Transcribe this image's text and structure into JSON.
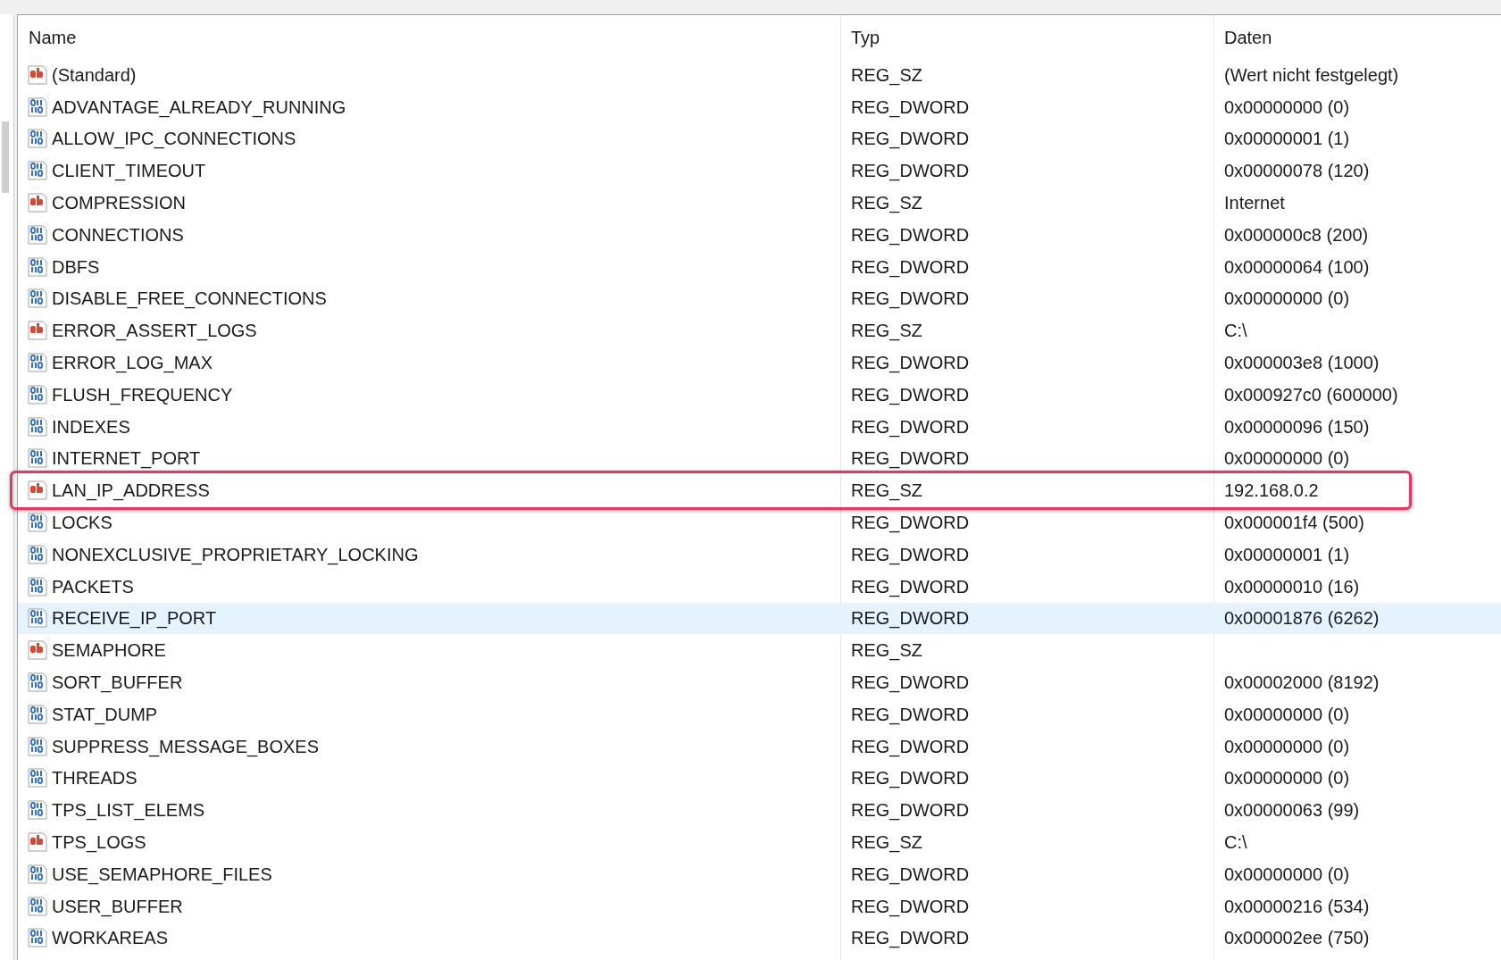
{
  "table": {
    "columns": [
      "Name",
      "Typ",
      "Daten"
    ],
    "rows": [
      {
        "kind": "sz",
        "name": "(Standard)",
        "type": "REG_SZ",
        "data": "(Wert nicht festgelegt)",
        "selected": false,
        "highlighted": false
      },
      {
        "kind": "dword",
        "name": "ADVANTAGE_ALREADY_RUNNING",
        "type": "REG_DWORD",
        "data": "0x00000000 (0)",
        "selected": false,
        "highlighted": false
      },
      {
        "kind": "dword",
        "name": "ALLOW_IPC_CONNECTIONS",
        "type": "REG_DWORD",
        "data": "0x00000001 (1)",
        "selected": false,
        "highlighted": false
      },
      {
        "kind": "dword",
        "name": "CLIENT_TIMEOUT",
        "type": "REG_DWORD",
        "data": "0x00000078 (120)",
        "selected": false,
        "highlighted": false
      },
      {
        "kind": "sz",
        "name": "COMPRESSION",
        "type": "REG_SZ",
        "data": "Internet",
        "selected": false,
        "highlighted": false
      },
      {
        "kind": "dword",
        "name": "CONNECTIONS",
        "type": "REG_DWORD",
        "data": "0x000000c8 (200)",
        "selected": false,
        "highlighted": false
      },
      {
        "kind": "dword",
        "name": "DBFS",
        "type": "REG_DWORD",
        "data": "0x00000064 (100)",
        "selected": false,
        "highlighted": false
      },
      {
        "kind": "dword",
        "name": "DISABLE_FREE_CONNECTIONS",
        "type": "REG_DWORD",
        "data": "0x00000000 (0)",
        "selected": false,
        "highlighted": false
      },
      {
        "kind": "sz",
        "name": "ERROR_ASSERT_LOGS",
        "type": "REG_SZ",
        "data": "C:\\",
        "selected": false,
        "highlighted": false
      },
      {
        "kind": "dword",
        "name": "ERROR_LOG_MAX",
        "type": "REG_DWORD",
        "data": "0x000003e8 (1000)",
        "selected": false,
        "highlighted": false
      },
      {
        "kind": "dword",
        "name": "FLUSH_FREQUENCY",
        "type": "REG_DWORD",
        "data": "0x000927c0 (600000)",
        "selected": false,
        "highlighted": false
      },
      {
        "kind": "dword",
        "name": "INDEXES",
        "type": "REG_DWORD",
        "data": "0x00000096 (150)",
        "selected": false,
        "highlighted": false
      },
      {
        "kind": "dword",
        "name": "INTERNET_PORT",
        "type": "REG_DWORD",
        "data": "0x00000000 (0)",
        "selected": false,
        "highlighted": false
      },
      {
        "kind": "sz",
        "name": "LAN_IP_ADDRESS",
        "type": "REG_SZ",
        "data": "192.168.0.2",
        "selected": false,
        "highlighted": true
      },
      {
        "kind": "dword",
        "name": "LOCKS",
        "type": "REG_DWORD",
        "data": "0x000001f4 (500)",
        "selected": false,
        "highlighted": false
      },
      {
        "kind": "dword",
        "name": "NONEXCLUSIVE_PROPRIETARY_LOCKING",
        "type": "REG_DWORD",
        "data": "0x00000001 (1)",
        "selected": false,
        "highlighted": false
      },
      {
        "kind": "dword",
        "name": "PACKETS",
        "type": "REG_DWORD",
        "data": "0x00000010 (16)",
        "selected": false,
        "highlighted": false
      },
      {
        "kind": "dword",
        "name": "RECEIVE_IP_PORT",
        "type": "REG_DWORD",
        "data": "0x00001876 (6262)",
        "selected": true,
        "highlighted": false
      },
      {
        "kind": "sz",
        "name": "SEMAPHORE",
        "type": "REG_SZ",
        "selected": false,
        "highlighted": false
      },
      {
        "kind": "dword",
        "name": "SORT_BUFFER",
        "type": "REG_DWORD",
        "data": "0x00002000 (8192)",
        "selected": false,
        "highlighted": false
      },
      {
        "kind": "dword",
        "name": "STAT_DUMP",
        "type": "REG_DWORD",
        "data": "0x00000000 (0)",
        "selected": false,
        "highlighted": false
      },
      {
        "kind": "dword",
        "name": "SUPPRESS_MESSAGE_BOXES",
        "type": "REG_DWORD",
        "data": "0x00000000 (0)",
        "selected": false,
        "highlighted": false
      },
      {
        "kind": "dword",
        "name": "THREADS",
        "type": "REG_DWORD",
        "data": "0x00000000 (0)",
        "selected": false,
        "highlighted": false
      },
      {
        "kind": "dword",
        "name": "TPS_LIST_ELEMS",
        "type": "REG_DWORD",
        "data": "0x00000063 (99)",
        "selected": false,
        "highlighted": false
      },
      {
        "kind": "sz",
        "name": "TPS_LOGS",
        "type": "REG_SZ",
        "data": "C:\\",
        "selected": false,
        "highlighted": false
      },
      {
        "kind": "dword",
        "name": "USE_SEMAPHORE_FILES",
        "type": "REG_DWORD",
        "data": "0x00000000 (0)",
        "selected": false,
        "highlighted": false
      },
      {
        "kind": "dword",
        "name": "USER_BUFFER",
        "type": "REG_DWORD",
        "data": "0x00000216 (534)",
        "selected": false,
        "highlighted": false
      },
      {
        "kind": "dword",
        "name": "WORKAREAS",
        "type": "REG_DWORD",
        "data": "0x000002ee (750)",
        "selected": false,
        "highlighted": false
      }
    ]
  }
}
